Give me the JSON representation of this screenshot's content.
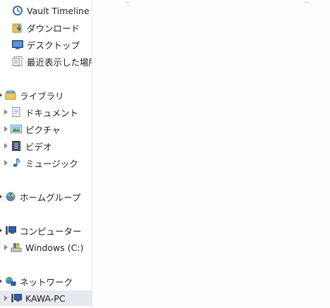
{
  "navigation_pane": {
    "favorites": [
      {
        "label": "Vault Timeline",
        "icon": "vault-timeline-icon"
      },
      {
        "label": "ダウンロード",
        "icon": "downloads-folder-icon"
      },
      {
        "label": "デスクトップ",
        "icon": "desktop-icon"
      },
      {
        "label": "最近表示した場所",
        "icon": "recent-places-icon"
      }
    ],
    "libraries": {
      "label": "ライブラリ",
      "icon": "library-folder-icon",
      "children": [
        {
          "label": "ドキュメント",
          "icon": "documents-icon"
        },
        {
          "label": "ピクチャ",
          "icon": "pictures-icon"
        },
        {
          "label": "ビデオ",
          "icon": "videos-icon"
        },
        {
          "label": "ミュージック",
          "icon": "music-icon"
        }
      ]
    },
    "homegroup": {
      "label": "ホームグループ",
      "icon": "homegroup-icon"
    },
    "computer": {
      "label": "コンピューター",
      "icon": "computer-icon",
      "children": [
        {
          "label": "Windows (C:)",
          "icon": "windows-drive-icon"
        }
      ]
    },
    "network": {
      "label": "ネットワーク",
      "icon": "network-icon",
      "children": [
        {
          "label": "KAWA-PC",
          "icon": "network-computer-icon",
          "selected": true
        }
      ]
    }
  },
  "colors": {
    "selection": "#e6eaf0",
    "pane_background": "#ffffff",
    "content_background": "#fdfdfe"
  }
}
